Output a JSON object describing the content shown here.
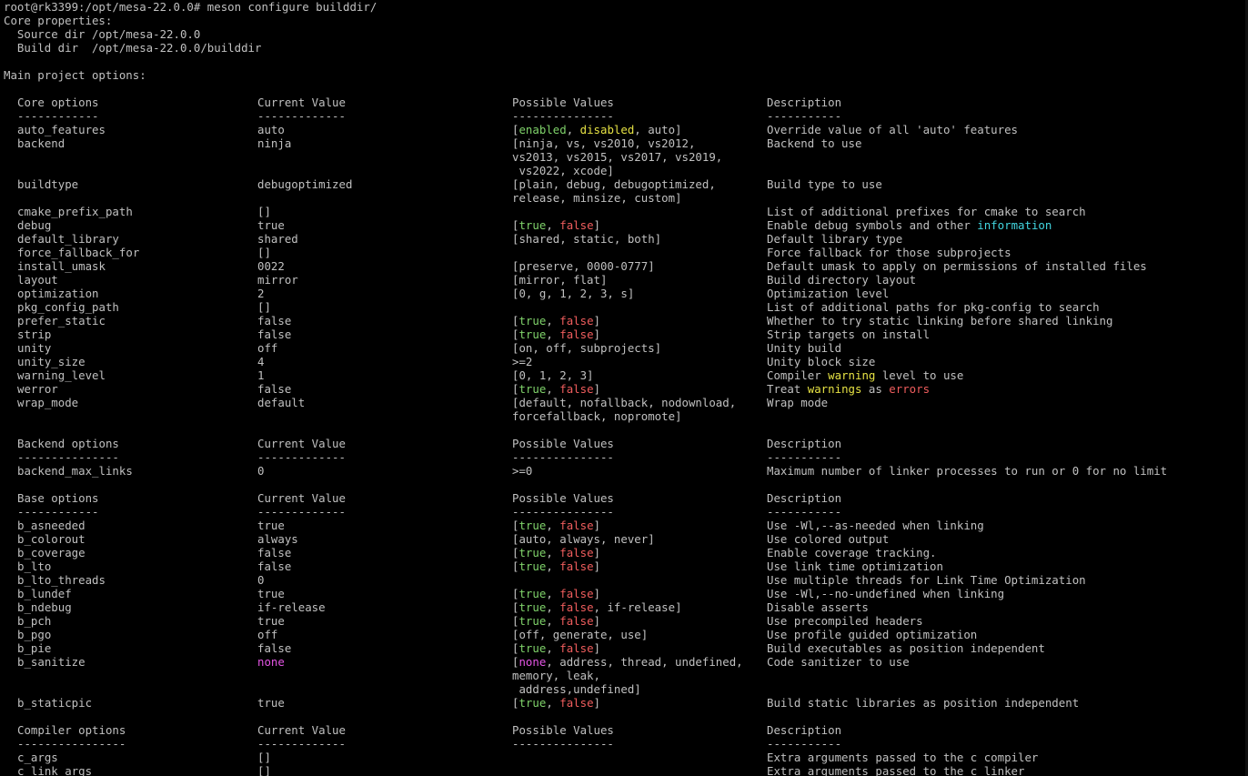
{
  "terminal": {
    "prompt": "root@rk3399:/opt/mesa-22.0.0# meson configure builddir/",
    "core_properties": "Core properties:",
    "source_dir": "  Source dir /opt/mesa-22.0.0",
    "build_dir": "  Build dir  /opt/mesa-22.0.0/builddir",
    "main_options": "Main project options:",
    "colors": {
      "true": "#7fd26a",
      "false": "#ef5d5d",
      "warning": "#e6e244",
      "info": "#42d6e0",
      "none": "#e455e4"
    }
  },
  "sections": [
    {
      "header": [
        "Core options",
        "Current Value",
        "Possible Values",
        "Description"
      ],
      "dashes": [
        "------------",
        "-------------",
        "---------------",
        "-----------"
      ],
      "rows": [
        {
          "name": "auto_features",
          "value": "auto",
          "possible": [
            [
              [
                "[",
                "w"
              ],
              [
                "enabled",
                "g"
              ],
              [
                ", ",
                "w"
              ],
              [
                "disabled",
                "y"
              ],
              [
                ", auto]",
                "w"
              ]
            ]
          ],
          "desc": [
            [
              "Override value of all 'auto' features",
              "w"
            ]
          ]
        },
        {
          "name": "backend",
          "value": "ninja",
          "possible": [
            [
              [
                "[ninja, vs, vs2010, vs2012,",
                "w"
              ]
            ],
            [
              [
                "vs2013, vs2015, vs2017, vs2019,",
                "w"
              ]
            ],
            [
              [
                " vs2022, xcode]",
                "w"
              ]
            ]
          ],
          "desc": [
            [
              "Backend to use",
              "w"
            ]
          ]
        },
        {
          "name": "buildtype",
          "value": "debugoptimized",
          "possible": [
            [
              [
                "[plain, debug, debugoptimized,",
                "w"
              ]
            ],
            [
              [
                "release, minsize, custom]",
                "w"
              ]
            ]
          ],
          "desc": [
            [
              "Build type to use",
              "w"
            ]
          ]
        },
        {
          "name": "cmake_prefix_path",
          "value": "[]",
          "possible": [
            [
              [
                "",
                "w"
              ]
            ]
          ],
          "desc": [
            [
              "List of additional prefixes for cmake to search",
              "w"
            ]
          ]
        },
        {
          "name": "debug",
          "value": "true",
          "possible": [
            [
              [
                "[",
                "w"
              ],
              [
                "true",
                "g"
              ],
              [
                ", ",
                "w"
              ],
              [
                "false",
                "r"
              ],
              [
                "]",
                "w"
              ]
            ]
          ],
          "desc": [
            [
              "Enable debug symbols and other ",
              "w"
            ],
            [
              "information",
              "cy"
            ]
          ]
        },
        {
          "name": "default_library",
          "value": "shared",
          "possible": [
            [
              [
                "[shared, static, both]",
                "w"
              ]
            ]
          ],
          "desc": [
            [
              "Default library type",
              "w"
            ]
          ]
        },
        {
          "name": "force_fallback_for",
          "value": "[]",
          "possible": [
            [
              [
                "",
                "w"
              ]
            ]
          ],
          "desc": [
            [
              "Force fallback for those subprojects",
              "w"
            ]
          ]
        },
        {
          "name": "install_umask",
          "value": "0022",
          "possible": [
            [
              [
                "[preserve, 0000-0777]",
                "w"
              ]
            ]
          ],
          "desc": [
            [
              "Default umask to apply on permissions of installed files",
              "w"
            ]
          ]
        },
        {
          "name": "layout",
          "value": "mirror",
          "possible": [
            [
              [
                "[mirror, flat]",
                "w"
              ]
            ]
          ],
          "desc": [
            [
              "Build directory layout",
              "w"
            ]
          ]
        },
        {
          "name": "optimization",
          "value": "2",
          "possible": [
            [
              [
                "[0, g, 1, 2, 3, s]",
                "w"
              ]
            ]
          ],
          "desc": [
            [
              "Optimization level",
              "w"
            ]
          ]
        },
        {
          "name": "pkg_config_path",
          "value": "[]",
          "possible": [
            [
              [
                "",
                "w"
              ]
            ]
          ],
          "desc": [
            [
              "List of additional paths for pkg-config to search",
              "w"
            ]
          ]
        },
        {
          "name": "prefer_static",
          "value": "false",
          "possible": [
            [
              [
                "[",
                "w"
              ],
              [
                "true",
                "g"
              ],
              [
                ", ",
                "w"
              ],
              [
                "false",
                "r"
              ],
              [
                "]",
                "w"
              ]
            ]
          ],
          "desc": [
            [
              "Whether to try static linking before shared linking",
              "w"
            ]
          ]
        },
        {
          "name": "strip",
          "value": "false",
          "possible": [
            [
              [
                "[",
                "w"
              ],
              [
                "true",
                "g"
              ],
              [
                ", ",
                "w"
              ],
              [
                "false",
                "r"
              ],
              [
                "]",
                "w"
              ]
            ]
          ],
          "desc": [
            [
              "Strip targets on install",
              "w"
            ]
          ]
        },
        {
          "name": "unity",
          "value": "off",
          "possible": [
            [
              [
                "[on, off, subprojects]",
                "w"
              ]
            ]
          ],
          "desc": [
            [
              "Unity build",
              "w"
            ]
          ]
        },
        {
          "name": "unity_size",
          "value": "4",
          "possible": [
            [
              [
                ">=2",
                "w"
              ]
            ]
          ],
          "desc": [
            [
              "Unity block size",
              "w"
            ]
          ]
        },
        {
          "name": "warning_level",
          "value": "1",
          "possible": [
            [
              [
                "[0, 1, 2, 3]",
                "w"
              ]
            ]
          ],
          "desc": [
            [
              "Compiler ",
              "w"
            ],
            [
              "warning",
              "y"
            ],
            [
              " level to use",
              "w"
            ]
          ]
        },
        {
          "name": "werror",
          "value": "false",
          "possible": [
            [
              [
                "[",
                "w"
              ],
              [
                "true",
                "g"
              ],
              [
                ", ",
                "w"
              ],
              [
                "false",
                "r"
              ],
              [
                "]",
                "w"
              ]
            ]
          ],
          "desc": [
            [
              "Treat ",
              "w"
            ],
            [
              "warnings",
              "y"
            ],
            [
              " as ",
              "w"
            ],
            [
              "errors",
              "r"
            ]
          ]
        },
        {
          "name": "wrap_mode",
          "value": "default",
          "possible": [
            [
              [
                "[default, nofallback, nodownload,",
                "w"
              ]
            ],
            [
              [
                "forcefallback, nopromote]",
                "w"
              ]
            ]
          ],
          "desc": [
            [
              "Wrap mode",
              "w"
            ]
          ]
        }
      ]
    },
    {
      "header": [
        "Backend options",
        "Current Value",
        "Possible Values",
        "Description"
      ],
      "dashes": [
        "---------------",
        "-------------",
        "---------------",
        "-----------"
      ],
      "rows": [
        {
          "name": "backend_max_links",
          "value": "0",
          "possible": [
            [
              [
                ">=0",
                "w"
              ]
            ]
          ],
          "desc": [
            [
              "Maximum number of linker processes to run or 0 for no limit",
              "w"
            ]
          ]
        }
      ]
    },
    {
      "header": [
        "Base options",
        "Current Value",
        "Possible Values",
        "Description"
      ],
      "dashes": [
        "------------",
        "-------------",
        "---------------",
        "-----------"
      ],
      "rows": [
        {
          "name": "b_asneeded",
          "value": "true",
          "possible": [
            [
              [
                "[",
                "w"
              ],
              [
                "true",
                "g"
              ],
              [
                ", ",
                "w"
              ],
              [
                "false",
                "r"
              ],
              [
                "]",
                "w"
              ]
            ]
          ],
          "desc": [
            [
              "Use -Wl,--as-needed when linking",
              "w"
            ]
          ]
        },
        {
          "name": "b_colorout",
          "value": "always",
          "possible": [
            [
              [
                "[auto, always, never]",
                "w"
              ]
            ]
          ],
          "desc": [
            [
              "Use colored output",
              "w"
            ]
          ]
        },
        {
          "name": "b_coverage",
          "value": "false",
          "possible": [
            [
              [
                "[",
                "w"
              ],
              [
                "true",
                "g"
              ],
              [
                ", ",
                "w"
              ],
              [
                "false",
                "r"
              ],
              [
                "]",
                "w"
              ]
            ]
          ],
          "desc": [
            [
              "Enable coverage tracking.",
              "w"
            ]
          ]
        },
        {
          "name": "b_lto",
          "value": "false",
          "possible": [
            [
              [
                "[",
                "w"
              ],
              [
                "true",
                "g"
              ],
              [
                ", ",
                "w"
              ],
              [
                "false",
                "r"
              ],
              [
                "]",
                "w"
              ]
            ]
          ],
          "desc": [
            [
              "Use link time optimization",
              "w"
            ]
          ]
        },
        {
          "name": "b_lto_threads",
          "value": "0",
          "possible": [
            [
              [
                "",
                "w"
              ]
            ]
          ],
          "desc": [
            [
              "Use multiple threads for Link Time Optimization",
              "w"
            ]
          ]
        },
        {
          "name": "b_lundef",
          "value": "true",
          "possible": [
            [
              [
                "[",
                "w"
              ],
              [
                "true",
                "g"
              ],
              [
                ", ",
                "w"
              ],
              [
                "false",
                "r"
              ],
              [
                "]",
                "w"
              ]
            ]
          ],
          "desc": [
            [
              "Use -Wl,--no-undefined when linking",
              "w"
            ]
          ]
        },
        {
          "name": "b_ndebug",
          "value": "if-release",
          "possible": [
            [
              [
                "[",
                "w"
              ],
              [
                "true",
                "g"
              ],
              [
                ", ",
                "w"
              ],
              [
                "false",
                "r"
              ],
              [
                ", if-release]",
                "w"
              ]
            ]
          ],
          "desc": [
            [
              "Disable asserts",
              "w"
            ]
          ]
        },
        {
          "name": "b_pch",
          "value": "true",
          "possible": [
            [
              [
                "[",
                "w"
              ],
              [
                "true",
                "g"
              ],
              [
                ", ",
                "w"
              ],
              [
                "false",
                "r"
              ],
              [
                "]",
                "w"
              ]
            ]
          ],
          "desc": [
            [
              "Use precompiled headers",
              "w"
            ]
          ]
        },
        {
          "name": "b_pgo",
          "value": "off",
          "possible": [
            [
              [
                "[off, generate, use]",
                "w"
              ]
            ]
          ],
          "desc": [
            [
              "Use profile guided optimization",
              "w"
            ]
          ]
        },
        {
          "name": "b_pie",
          "value": "false",
          "possible": [
            [
              [
                "[",
                "w"
              ],
              [
                "true",
                "g"
              ],
              [
                ", ",
                "w"
              ],
              [
                "false",
                "r"
              ],
              [
                "]",
                "w"
              ]
            ]
          ],
          "desc": [
            [
              "Build executables as position independent",
              "w"
            ]
          ]
        },
        {
          "name": "b_sanitize",
          "value": "none",
          "value_color": "m",
          "possible": [
            [
              [
                "[",
                "w"
              ],
              [
                "none",
                "m"
              ],
              [
                ", address, thread, undefined,",
                "w"
              ]
            ],
            [
              [
                "memory, leak,",
                "w"
              ]
            ],
            [
              [
                " address,undefined]",
                "w"
              ]
            ]
          ],
          "desc": [
            [
              "Code sanitizer to use",
              "w"
            ]
          ]
        },
        {
          "name": "b_staticpic",
          "value": "true",
          "possible": [
            [
              [
                "[",
                "w"
              ],
              [
                "true",
                "g"
              ],
              [
                ", ",
                "w"
              ],
              [
                "false",
                "r"
              ],
              [
                "]",
                "w"
              ]
            ]
          ],
          "desc": [
            [
              "Build static libraries as position independent",
              "w"
            ]
          ]
        }
      ]
    },
    {
      "header": [
        "Compiler options",
        "Current Value",
        "Possible Values",
        "Description"
      ],
      "dashes": [
        "----------------",
        "-------------",
        "---------------",
        "-----------"
      ],
      "rows": [
        {
          "name": "c_args",
          "value": "[]",
          "possible": [
            [
              [
                "",
                "w"
              ]
            ]
          ],
          "desc": [
            [
              "Extra arguments passed to the c compiler",
              "w"
            ]
          ]
        },
        {
          "name": "c_link_args",
          "value": "[]",
          "possible": [
            [
              [
                "",
                "w"
              ]
            ]
          ],
          "desc": [
            [
              "Extra arguments passed to the c linker",
              "w"
            ]
          ]
        }
      ]
    }
  ]
}
